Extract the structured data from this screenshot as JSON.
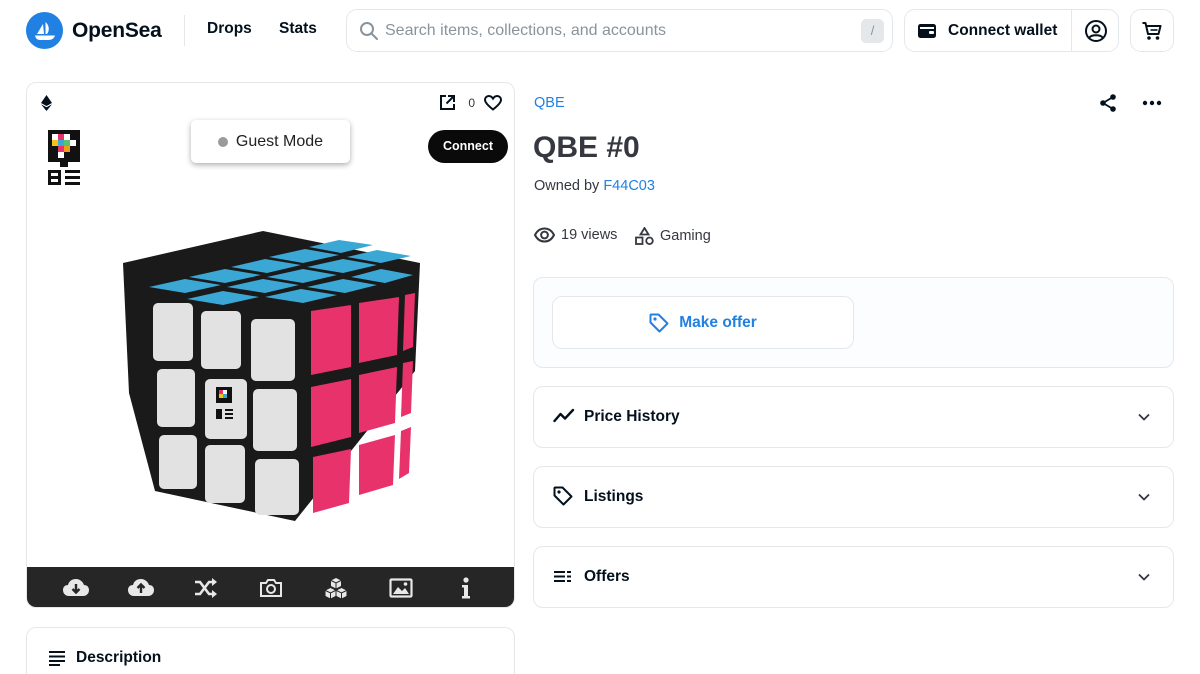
{
  "header": {
    "logo_text": "OpenSea",
    "nav": [
      "Drops",
      "Stats"
    ],
    "search": {
      "placeholder": "Search items, collections, and accounts",
      "shortcut": "/"
    },
    "connect_wallet_label": "Connect wallet",
    "icons": {
      "logo": "opensea-logo-icon",
      "search": "search-icon",
      "wallet": "wallet-icon",
      "profile": "account-circle-icon",
      "cart": "cart-icon"
    }
  },
  "media": {
    "chain_icon": "ethereum-icon",
    "favorites_count": "0",
    "guest_mode_label": "Guest Mode",
    "connect_label": "Connect",
    "toolbar_icons": [
      "download-icon",
      "upload-icon",
      "shuffle-icon",
      "camera-icon",
      "cubes-icon",
      "image-icon",
      "info-icon"
    ],
    "cube_colors": {
      "top": "#3aa7d4",
      "left": "#e2e2e2",
      "right": "#e8326c",
      "body": "#1a1a1a"
    }
  },
  "description": {
    "title": "Description"
  },
  "item": {
    "collection": "QBE",
    "title": "QBE #0",
    "owned_by_prefix": "Owned by",
    "owner": "F44C03",
    "views": "19 views",
    "category": "Gaming",
    "make_offer_label": "Make offer"
  },
  "panels": [
    {
      "title": "Price History",
      "icon": "price-history-icon"
    },
    {
      "title": "Listings",
      "icon": "tag-icon"
    },
    {
      "title": "Offers",
      "icon": "list-icon"
    }
  ],
  "colors": {
    "accent": "#2081e2",
    "text": "#353840",
    "border": "#e5e8eb"
  }
}
